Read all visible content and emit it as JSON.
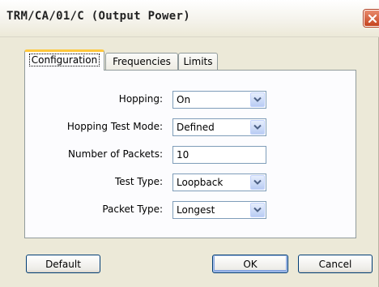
{
  "window": {
    "title": "TRM/CA/01/C (Output Power)"
  },
  "tabs": [
    {
      "label": "Configuration",
      "active": true
    },
    {
      "label": "Frequencies",
      "active": false
    },
    {
      "label": "Limits",
      "active": false
    }
  ],
  "form": {
    "hopping": {
      "label": "Hopping:",
      "value": "On"
    },
    "hopping_test_mode": {
      "label": "Hopping Test Mode:",
      "value": "Defined"
    },
    "number_of_packets": {
      "label": "Number of Packets:",
      "value": "10"
    },
    "test_type": {
      "label": "Test Type:",
      "value": "Loopback"
    },
    "packet_type": {
      "label": "Packet Type:",
      "value": "Longest"
    }
  },
  "buttons": {
    "default": "Default",
    "ok": "OK",
    "cancel": "Cancel"
  },
  "icons": {
    "close": "close-icon",
    "dropdown": "chevron-down-icon"
  },
  "colors": {
    "close_button": "#c5441f",
    "tab_highlight": "#ffc83c",
    "field_border": "#7f9db9"
  }
}
